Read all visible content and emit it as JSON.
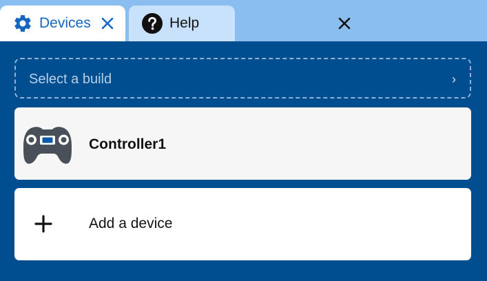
{
  "tabs": [
    {
      "label": "Devices",
      "icon": "gear-icon",
      "active": true
    },
    {
      "label": "Help",
      "icon": "question-circle-icon",
      "active": false
    }
  ],
  "build_select": {
    "placeholder": "Select a build",
    "chevron": "›"
  },
  "devices": [
    {
      "name": "Controller1",
      "icon": "gamepad-icon"
    }
  ],
  "add_device": {
    "label": "Add a device",
    "icon": "plus-icon"
  },
  "colors": {
    "background": "#004d8f",
    "tabbar": "#8bbef0",
    "active_tab": "#ffffff",
    "inactive_tab": "#c8e2fb",
    "accent": "#1566c0"
  }
}
